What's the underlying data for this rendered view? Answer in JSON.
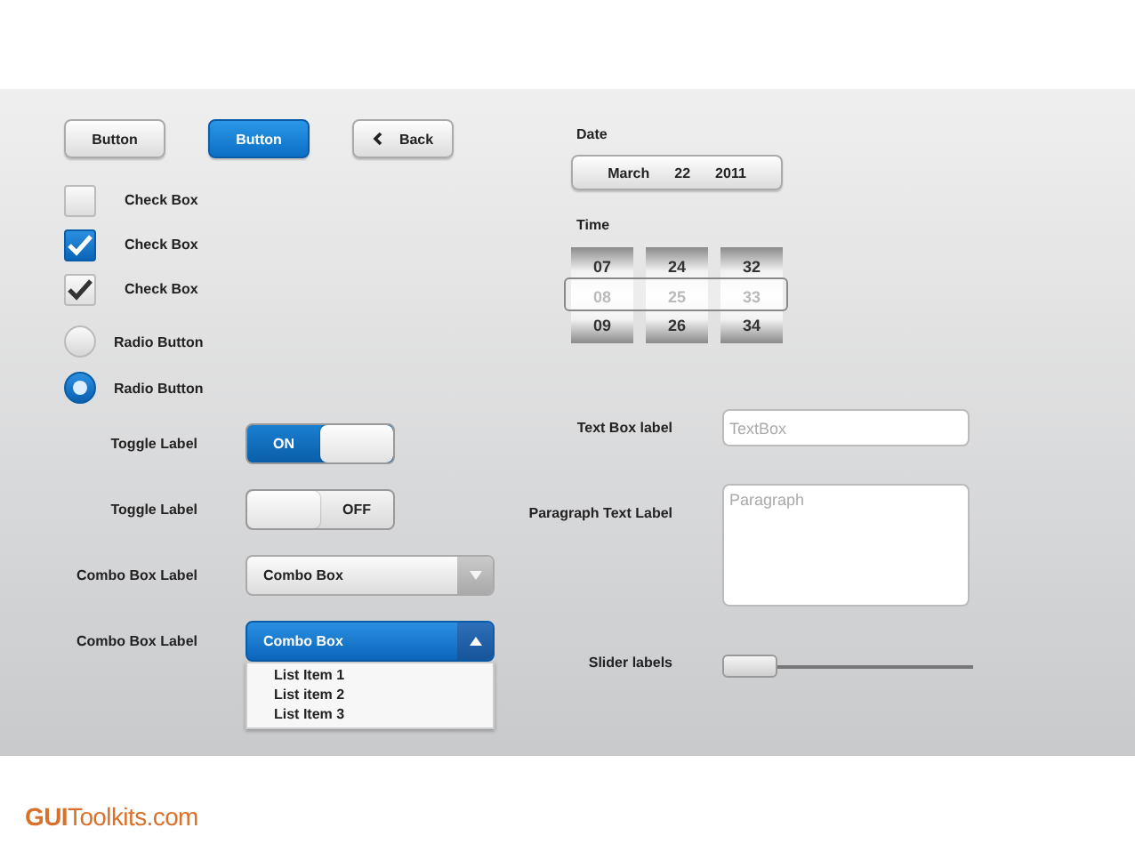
{
  "buttons": [
    {
      "label": "Button",
      "kind": "default"
    },
    {
      "label": "Button",
      "kind": "primary"
    },
    {
      "label": "Back",
      "kind": "back"
    }
  ],
  "checkboxes": [
    {
      "label": "Check Box",
      "checked": false,
      "kind": "plain"
    },
    {
      "label": "Check Box",
      "checked": true,
      "kind": "blue"
    },
    {
      "label": "Check Box",
      "checked": true,
      "kind": "dark"
    }
  ],
  "radios": [
    {
      "label": "Radio Button",
      "selected": false
    },
    {
      "label": "Radio Button",
      "selected": true
    }
  ],
  "toggles": [
    {
      "label": "Toggle Label",
      "on": true,
      "text": "ON"
    },
    {
      "label": "Toggle Label",
      "on": false,
      "text": "OFF"
    }
  ],
  "combos": [
    {
      "label": "Combo Box Label",
      "value": "Combo Box",
      "expanded": false
    },
    {
      "label": "Combo Box Label",
      "value": "Combo Box",
      "expanded": true,
      "items": [
        "List Item 1",
        "List item 2",
        "List Item 3"
      ]
    }
  ],
  "date": {
    "label": "Date",
    "month": "March",
    "day": "22",
    "year": "2011"
  },
  "time": {
    "label": "Time",
    "columns": [
      {
        "above": "07",
        "selected": "08",
        "below": "09"
      },
      {
        "above": "24",
        "selected": "25",
        "below": "26"
      },
      {
        "above": "32",
        "selected": "33",
        "below": "34"
      }
    ]
  },
  "text_box": {
    "label": "Text Box label",
    "placeholder": "TextBox"
  },
  "paragraph": {
    "label": "Paragraph Text Label",
    "placeholder": "Paragraph"
  },
  "slider": {
    "label": "Slider labels",
    "level": 0
  },
  "brand": "**GUI**Toolkits.com"
}
